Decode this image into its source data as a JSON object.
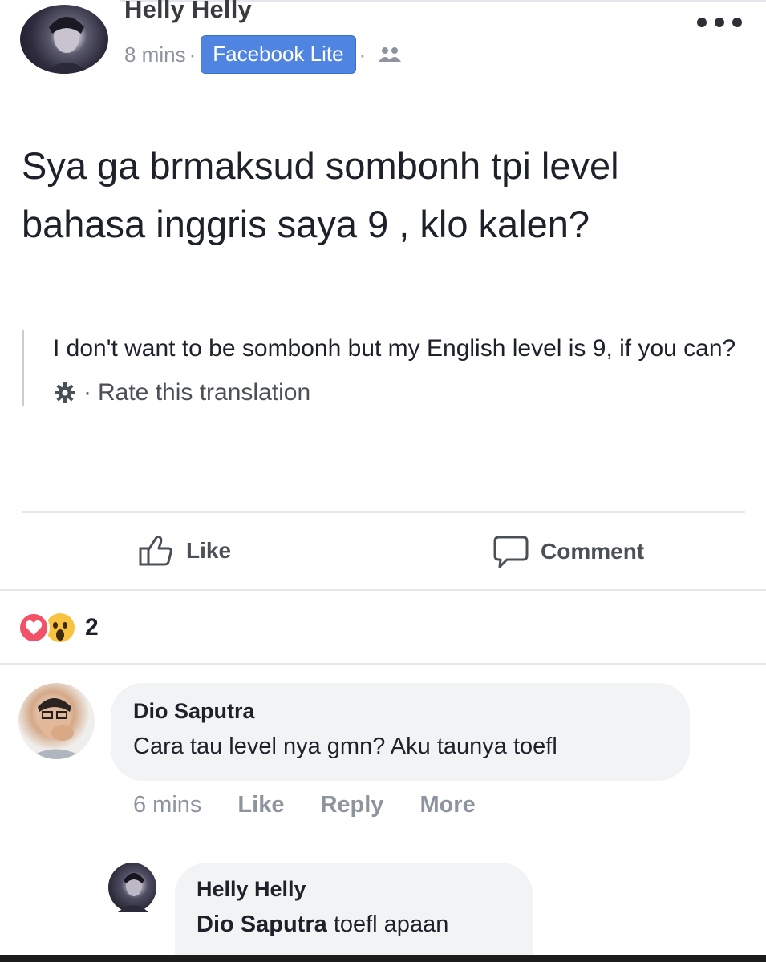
{
  "post": {
    "author": "Helly Helly",
    "time": "8 mins",
    "source": "Facebook Lite",
    "text": "Sya ga brmaksud sombonh tpi level bahasa inggris saya 9 , klo kalen?",
    "translation": "I don't want to be sombonh but my English level is 9, if you can?",
    "rate_translation": "Rate this translation"
  },
  "actions": {
    "like": "Like",
    "comment": "Comment"
  },
  "reactions": {
    "count": "2",
    "types": [
      "love",
      "wow"
    ]
  },
  "comments": [
    {
      "author": "Dio Saputra",
      "text": "Cara tau level nya gmn? Aku taunya toefl",
      "time": "6 mins",
      "like": "Like",
      "reply": "Reply",
      "more": "More"
    },
    {
      "author": "Helly Helly",
      "mention": "Dio Saputra",
      "text": "toefl apaan"
    }
  ],
  "colors": {
    "source_badge": "#4f84e0",
    "love": "#f25268",
    "wow": "#f7c341",
    "bubble": "#f2f3f5"
  }
}
